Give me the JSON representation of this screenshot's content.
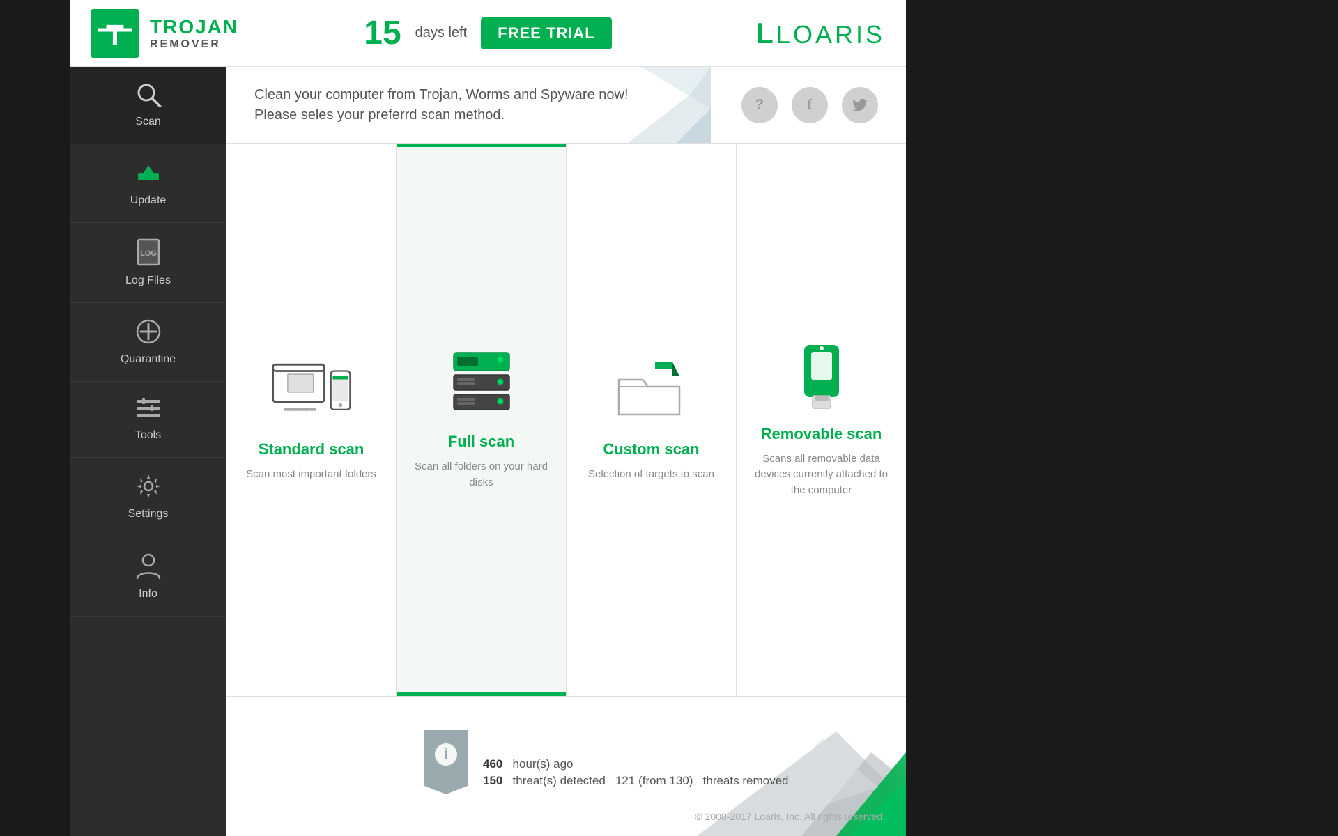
{
  "header": {
    "logo_trojan": "TROJAN",
    "logo_remover": "REMOVER",
    "days_count": "15",
    "days_label": "days left",
    "trial_badge": "FREE TRIAL",
    "loaris_label": "LOARIS"
  },
  "sidebar": {
    "items": [
      {
        "id": "scan",
        "label": "Scan",
        "icon": "🔍",
        "active": true
      },
      {
        "id": "update",
        "label": "Update",
        "icon": "⬇",
        "active": false
      },
      {
        "id": "log-files",
        "label": "Log Files",
        "icon": "📋",
        "active": false
      },
      {
        "id": "quarantine",
        "label": "Quarantine",
        "icon": "➕",
        "active": false
      },
      {
        "id": "tools",
        "label": "Tools",
        "icon": "☰",
        "active": false
      },
      {
        "id": "settings",
        "label": "Settings",
        "icon": "⚙",
        "active": false
      },
      {
        "id": "info",
        "label": "Info",
        "icon": "👤",
        "active": false
      }
    ]
  },
  "banner": {
    "line1": "Clean your computer from Trojan, Worms and Spyware now!",
    "line2": "Please seles your preferrd scan method.",
    "help_icon": "?",
    "facebook_icon": "f",
    "twitter_icon": "t"
  },
  "scan_options": {
    "cards": [
      {
        "id": "standard",
        "title": "Standard scan",
        "desc": "Scan most important folders",
        "selected": false
      },
      {
        "id": "full",
        "title": "Full scan",
        "desc": "Scan all folders on your hard disks",
        "selected": true
      },
      {
        "id": "custom",
        "title": "Custom scan",
        "desc": "Selection of targets to scan",
        "selected": false
      },
      {
        "id": "removable",
        "title": "Removable scan",
        "desc": "Scans all removable data devices currently attached to the computer",
        "selected": false
      }
    ]
  },
  "bottom_info": {
    "stat1_num": "460",
    "stat1_label": "hour(s) ago",
    "stat2_num": "150",
    "stat2_label": "threat(s) detected",
    "stat2_mid": "121 (from 130)",
    "stat2_end": "threats removed",
    "copyright": "© 2008-2017 Loaris, Inc. All rights reserved."
  }
}
